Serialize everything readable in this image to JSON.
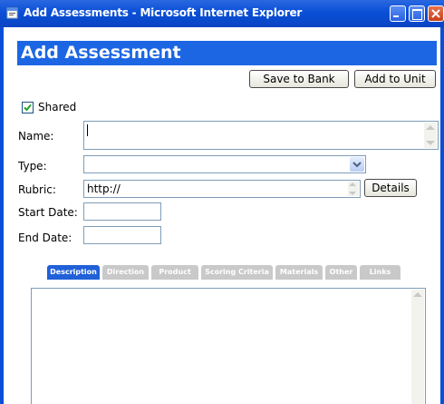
{
  "window": {
    "title": "Add Assessments - Microsoft Internet Explorer"
  },
  "header": {
    "title": "Add Assessment"
  },
  "toolbar": {
    "save_to_bank": "Save to Bank",
    "add_to_unit": "Add to Unit"
  },
  "form": {
    "shared_label": "Shared",
    "shared_checked": true,
    "name_label": "Name:",
    "type_label": "Type:",
    "rubric_label": "Rubric:",
    "rubric_value": "http://",
    "details_label": "Details",
    "start_date_label": "Start Date:",
    "end_date_label": "End Date:"
  },
  "tabs": [
    {
      "label": "Description",
      "active": true
    },
    {
      "label": "Direction",
      "active": false
    },
    {
      "label": "Product",
      "active": false
    },
    {
      "label": "Scoring Criteria",
      "active": false
    },
    {
      "label": "Materials",
      "active": false
    },
    {
      "label": "Other",
      "active": false
    },
    {
      "label": "Links",
      "active": false
    }
  ],
  "colors": {
    "titlebar": "#0a4fd6",
    "header": "#1c66e4",
    "tab_active": "#2060d8",
    "tab_inactive": "#c9c9c9"
  }
}
